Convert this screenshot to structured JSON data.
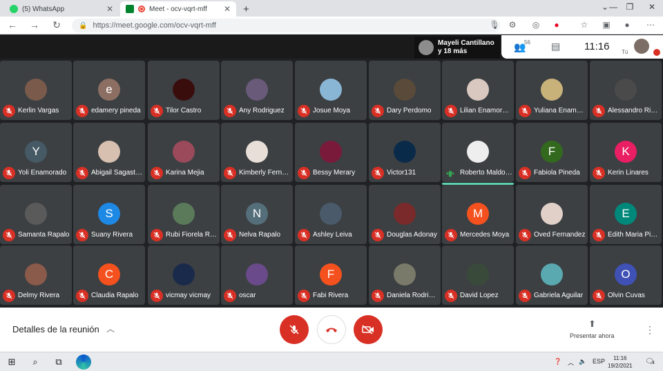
{
  "browser": {
    "tabs": [
      {
        "label": "(5) WhatsApp",
        "icon": "whatsapp-icon",
        "active": false
      },
      {
        "label": "Meet - ocv-vqrt-mff",
        "icon": "meet-icon",
        "active": true
      }
    ],
    "new_tab": "+",
    "url": "https://meet.google.com/ocv-vqrt-mff"
  },
  "meet": {
    "presenter": {
      "line1": "Mayeli Cantillano",
      "line2": "y 18 más"
    },
    "people_count": "56",
    "time": "11:16",
    "you_label": "Tú",
    "details_label": "Detalles de la reunión",
    "present_label": "Presentar ahora",
    "participants": [
      {
        "name": "Kerlin Vargas",
        "initial": "",
        "bg": "#7a5a4a"
      },
      {
        "name": "edamery pineda",
        "initial": "e",
        "bg": "#8d6e63"
      },
      {
        "name": "Tilor Castro",
        "initial": "",
        "bg": "#3a0d0d"
      },
      {
        "name": "Any Rodriguez",
        "initial": "",
        "bg": "#6a5a7a"
      },
      {
        "name": "Josue Moya",
        "initial": "",
        "bg": "#8ab6d6"
      },
      {
        "name": "Dary Perdomo",
        "initial": "",
        "bg": "#5a4a3a"
      },
      {
        "name": "Lilian Enamorado",
        "initial": "",
        "bg": "#d9c8c0"
      },
      {
        "name": "Yuliana Enamorado",
        "initial": "",
        "bg": "#c9b27a"
      },
      {
        "name": "Alessandro Rivera",
        "initial": "",
        "bg": "#4a4a4a"
      },
      {
        "name": "Yoli Enamorado",
        "initial": "Y",
        "bg": "#455a64"
      },
      {
        "name": "Abigail Sagastume",
        "initial": "",
        "bg": "#d8c0b0"
      },
      {
        "name": "Karina Mejia",
        "initial": "",
        "bg": "#9a4a5a"
      },
      {
        "name": "Kimberly Fernandez",
        "initial": "",
        "bg": "#e8e0d8"
      },
      {
        "name": "Bessy Merary",
        "initial": "",
        "bg": "#7a1a3a"
      },
      {
        "name": "Victor131",
        "initial": "",
        "bg": "#0a2a4a"
      },
      {
        "name": "Roberto Maldonado",
        "initial": "",
        "bg": "#eeeeee"
      },
      {
        "name": "Fabiola Pineda",
        "initial": "F",
        "bg": "#33691e"
      },
      {
        "name": "Kerin Linares",
        "initial": "K",
        "bg": "#e91e63"
      },
      {
        "name": "Samanta Rapalo",
        "initial": "",
        "bg": "#5a5a5a"
      },
      {
        "name": "Suany Rivera",
        "initial": "S",
        "bg": "#1e88e5"
      },
      {
        "name": "Rubi Fiorela Rapalo",
        "initial": "",
        "bg": "#5a7a5a"
      },
      {
        "name": "Nelva Rapalo",
        "initial": "N",
        "bg": "#546e7a"
      },
      {
        "name": "Ashley Leiva",
        "initial": "",
        "bg": "#4a5a6a"
      },
      {
        "name": "Douglas Adonay",
        "initial": "",
        "bg": "#7a2a2a"
      },
      {
        "name": "Mercedes Moya",
        "initial": "M",
        "bg": "#f4511e"
      },
      {
        "name": "Oved Fernandez",
        "initial": "",
        "bg": "#e0d0c8"
      },
      {
        "name": "Edith Maria Pineda",
        "initial": "E",
        "bg": "#00897b"
      },
      {
        "name": "Delmy Rivera",
        "initial": "",
        "bg": "#8a5a4a"
      },
      {
        "name": "Claudia Rapalo",
        "initial": "C",
        "bg": "#f4511e"
      },
      {
        "name": "vicmay vicmay",
        "initial": "",
        "bg": "#1a2a4a"
      },
      {
        "name": "oscar",
        "initial": "",
        "bg": "#6a4a8a"
      },
      {
        "name": "Fabi Rivera",
        "initial": "F",
        "bg": "#f4511e"
      },
      {
        "name": "Daniela Rodriguez",
        "initial": "",
        "bg": "#7a7a6a"
      },
      {
        "name": "David Lopez",
        "initial": "",
        "bg": "#3a4a3a"
      },
      {
        "name": "Gabriela Aguilar",
        "initial": "",
        "bg": "#5aa8b0"
      },
      {
        "name": "Olvin Cuvas",
        "initial": "O",
        "bg": "#3f51b5"
      }
    ]
  },
  "taskbar": {
    "lang": "ESP",
    "time": "11:16",
    "date": "19/2/2021",
    "notifications": "4"
  },
  "colors": {
    "danger": "#d93025",
    "active_speaker": "#5ecfb1"
  }
}
